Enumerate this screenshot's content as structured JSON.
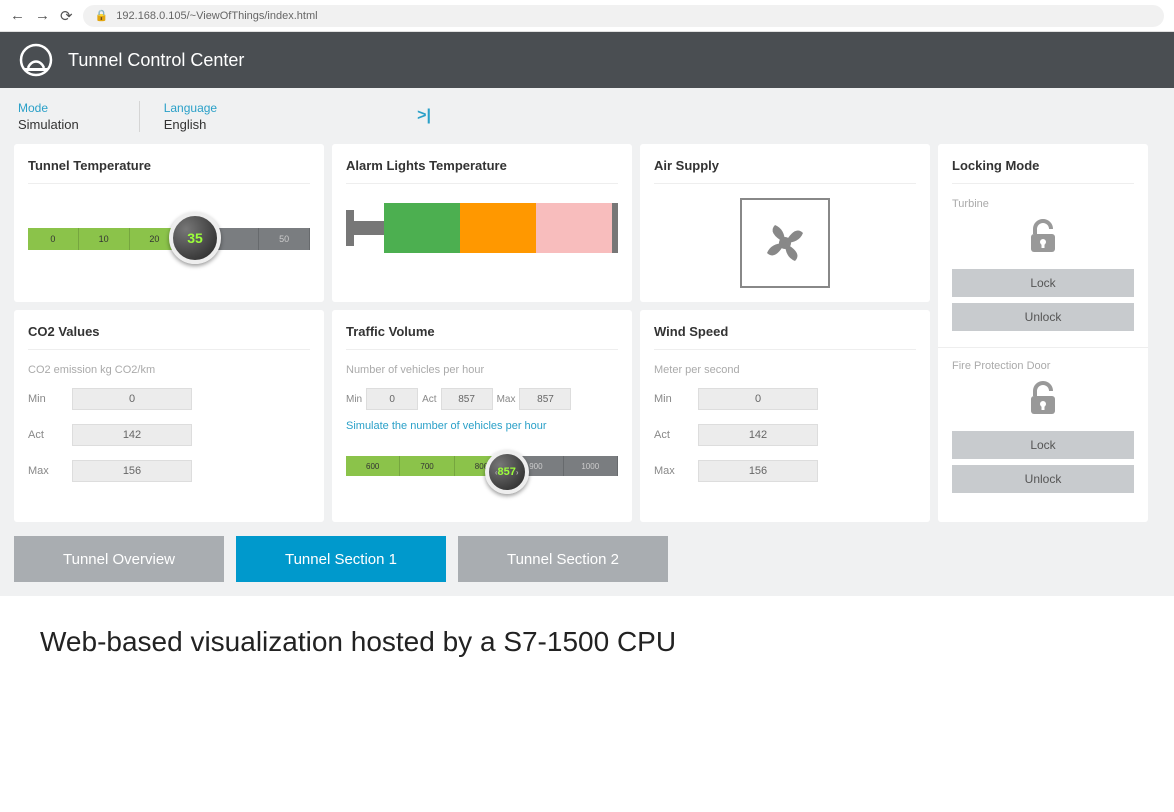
{
  "browser": {
    "url": "192.168.0.105/~ViewOfThings/index.html"
  },
  "app": {
    "title": "Tunnel Control Center"
  },
  "subheader": {
    "mode_label": "Mode",
    "mode_value": "Simulation",
    "lang_label": "Language",
    "lang_value": "English",
    "collapse": ">|"
  },
  "cards": {
    "temp": {
      "title": "Tunnel Temperature",
      "ticks": [
        "0",
        "10",
        "20",
        "",
        "50"
      ],
      "value": "35"
    },
    "alarm": {
      "title": "Alarm Lights Temperature"
    },
    "air": {
      "title": "Air Supply"
    },
    "lock": {
      "title": "Locking Mode",
      "turbine_label": "Turbine",
      "fire_label": "Fire Protection Door",
      "lock_btn": "Lock",
      "unlock_btn": "Unlock"
    },
    "co2": {
      "title": "CO2 Values",
      "sub": "CO2 emission kg CO2/km",
      "min_label": "Min",
      "min": "0",
      "act_label": "Act",
      "act": "142",
      "max_label": "Max",
      "max": "156"
    },
    "traffic": {
      "title": "Traffic Volume",
      "sub": "Number of vehicles per hour",
      "min_label": "Min",
      "min": "0",
      "act_label": "Act",
      "act": "857",
      "max_label": "Max",
      "max": "857",
      "sim_label": "Simulate the number of vehicles per hour",
      "ticks": [
        "600",
        "700",
        "800",
        "900",
        "1000"
      ],
      "value": "857"
    },
    "wind": {
      "title": "Wind Speed",
      "sub": "Meter per second",
      "min_label": "Min",
      "min": "0",
      "act_label": "Act",
      "act": "142",
      "max_label": "Max",
      "max": "156"
    }
  },
  "tabs": {
    "overview": "Tunnel Overview",
    "s1": "Tunnel Section 1",
    "s2": "Tunnel Section 2"
  },
  "caption": "Web-based visualization hosted by a S7-1500 CPU"
}
